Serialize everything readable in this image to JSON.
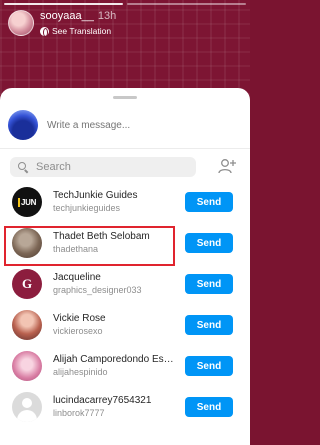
{
  "story": {
    "username": "sooyaaa__",
    "time": "13h",
    "translate_label": "See Translation"
  },
  "share": {
    "message_placeholder": "Write a message...",
    "search_placeholder": "Search",
    "send_label": "Send"
  },
  "contacts": [
    {
      "name": "TechJunkie Guides",
      "handle": "techjunkieguides",
      "avatar_text": "JUN"
    },
    {
      "name": "Thadet Beth Selobam",
      "handle": "thadethana"
    },
    {
      "name": "Jacqueline",
      "handle": "graphics_designer033",
      "avatar_text": "G"
    },
    {
      "name": "Vickie Rose",
      "handle": "vickierosexo"
    },
    {
      "name": "Alijah Camporedondo Espinido",
      "handle": "alijahespinido"
    },
    {
      "name": "lucindacarrey7654321",
      "handle": "linborok7777"
    }
  ],
  "colors": {
    "accent": "#0095f6",
    "highlight": "#e0242e",
    "story_bg": "#7d1533"
  }
}
